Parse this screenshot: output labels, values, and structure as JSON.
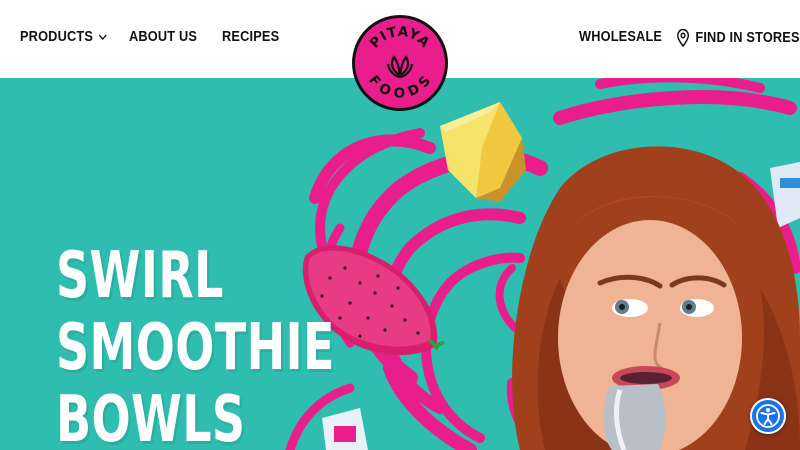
{
  "nav": {
    "products": "PRODUCTS",
    "about": "ABOUT US",
    "recipes": "RECIPES",
    "wholesale": "WHOLESALE",
    "find_in_stores": "FIND IN STORES"
  },
  "logo": {
    "top_text": "PITAYA",
    "bottom_text": "FOODS"
  },
  "hero": {
    "headline": [
      "SWIRL",
      "SMOOTHIE",
      "BOWLS"
    ]
  },
  "icons": {
    "chevron": "chevron-down-icon",
    "pin": "map-pin-icon",
    "accessibility": "accessibility-icon"
  },
  "colors": {
    "teal": "#2fbdb0",
    "pink": "#e91e8c",
    "text": "#111111",
    "a11y_blue": "#1a73e8"
  }
}
